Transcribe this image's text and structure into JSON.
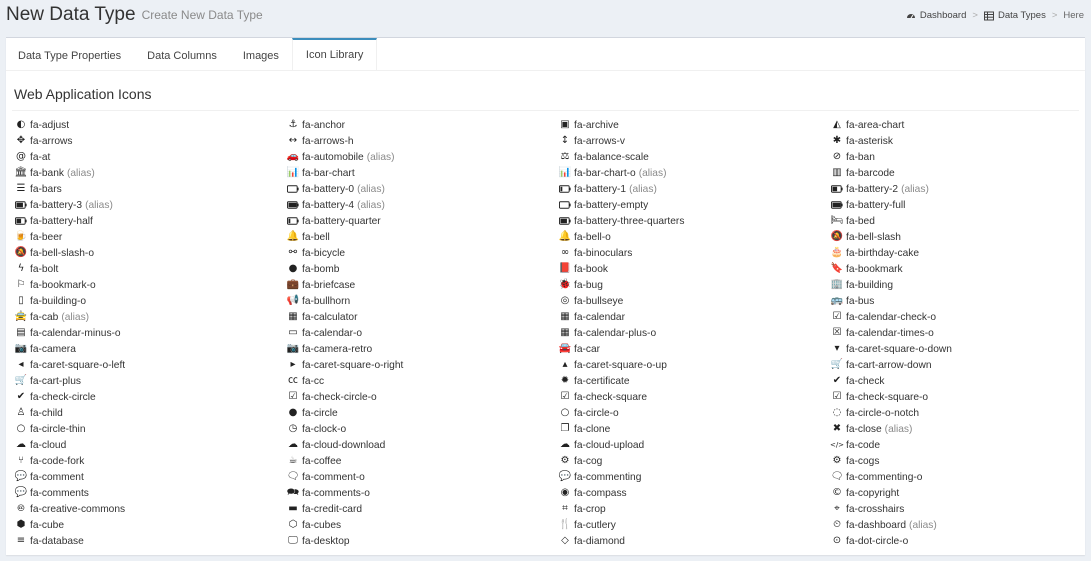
{
  "header": {
    "title": "New Data Type",
    "subtitle": "Create New Data Type",
    "breadcrumb": [
      {
        "label": "Dashboard",
        "icon": "dashboard-icon"
      },
      {
        "label": "Data Types",
        "icon": "table-icon"
      },
      {
        "label": "Here",
        "icon": ""
      }
    ],
    "breadcrumb_sep": ">"
  },
  "tabs": [
    "Data Type Properties",
    "Data Columns",
    "Images",
    "Icon Library"
  ],
  "active_tab": "Icon Library",
  "section_title": "Web Application Icons",
  "alias_label": "(alias)",
  "columns": [
    [
      {
        "name": "fa-adjust",
        "glyph": "◐"
      },
      {
        "name": "fa-arrows",
        "glyph": "✥"
      },
      {
        "name": "fa-at",
        "glyph": "@"
      },
      {
        "name": "fa-bank",
        "alias": true,
        "glyph": "🏛"
      },
      {
        "name": "fa-bars",
        "glyph": "☰"
      },
      {
        "name": "fa-battery-3",
        "alias": true,
        "glyph": "bat3"
      },
      {
        "name": "fa-battery-half",
        "glyph": "bat2"
      },
      {
        "name": "fa-beer",
        "glyph": "🍺"
      },
      {
        "name": "fa-bell-slash-o",
        "glyph": "🔕"
      },
      {
        "name": "fa-bolt",
        "glyph": "ϟ"
      },
      {
        "name": "fa-bookmark-o",
        "glyph": "⚐"
      },
      {
        "name": "fa-building-o",
        "glyph": "▯"
      },
      {
        "name": "fa-cab",
        "alias": true,
        "glyph": "🚖"
      },
      {
        "name": "fa-calendar-minus-o",
        "glyph": "▤"
      },
      {
        "name": "fa-camera",
        "glyph": "📷"
      },
      {
        "name": "fa-caret-square-o-left",
        "glyph": "◂"
      },
      {
        "name": "fa-cart-plus",
        "glyph": "🛒"
      },
      {
        "name": "fa-check-circle",
        "glyph": "✔"
      },
      {
        "name": "fa-child",
        "glyph": "♙"
      },
      {
        "name": "fa-circle-thin",
        "glyph": "○"
      },
      {
        "name": "fa-cloud",
        "glyph": "☁"
      },
      {
        "name": "fa-code-fork",
        "glyph": "⑂"
      },
      {
        "name": "fa-comment",
        "glyph": "💬"
      },
      {
        "name": "fa-comments",
        "glyph": "💬"
      },
      {
        "name": "fa-creative-commons",
        "glyph": "🅭"
      },
      {
        "name": "fa-cube",
        "glyph": "⬢"
      },
      {
        "name": "fa-database",
        "glyph": "≡"
      }
    ],
    [
      {
        "name": "fa-anchor",
        "glyph": "⚓"
      },
      {
        "name": "fa-arrows-h",
        "glyph": "↔"
      },
      {
        "name": "fa-automobile",
        "alias": true,
        "glyph": "🚗"
      },
      {
        "name": "fa-bar-chart",
        "glyph": "📊"
      },
      {
        "name": "fa-battery-0",
        "alias": true,
        "glyph": "bat0"
      },
      {
        "name": "fa-battery-4",
        "alias": true,
        "glyph": "bat4"
      },
      {
        "name": "fa-battery-quarter",
        "glyph": "bat1"
      },
      {
        "name": "fa-bell",
        "glyph": "🔔"
      },
      {
        "name": "fa-bicycle",
        "glyph": "⚯"
      },
      {
        "name": "fa-bomb",
        "glyph": "●"
      },
      {
        "name": "fa-briefcase",
        "glyph": "💼"
      },
      {
        "name": "fa-bullhorn",
        "glyph": "📢"
      },
      {
        "name": "fa-calculator",
        "glyph": "▦"
      },
      {
        "name": "fa-calendar-o",
        "glyph": "▭"
      },
      {
        "name": "fa-camera-retro",
        "glyph": "📷"
      },
      {
        "name": "fa-caret-square-o-right",
        "glyph": "▸"
      },
      {
        "name": "fa-cc",
        "glyph": "㏄"
      },
      {
        "name": "fa-check-circle-o",
        "glyph": "☑"
      },
      {
        "name": "fa-circle",
        "glyph": "●"
      },
      {
        "name": "fa-clock-o",
        "glyph": "◷"
      },
      {
        "name": "fa-cloud-download",
        "glyph": "☁"
      },
      {
        "name": "fa-coffee",
        "glyph": "☕"
      },
      {
        "name": "fa-comment-o",
        "glyph": "🗨"
      },
      {
        "name": "fa-comments-o",
        "glyph": "🗪"
      },
      {
        "name": "fa-credit-card",
        "glyph": "▬"
      },
      {
        "name": "fa-cubes",
        "glyph": "⬡"
      },
      {
        "name": "fa-desktop",
        "glyph": "🖵"
      }
    ],
    [
      {
        "name": "fa-archive",
        "glyph": "▣"
      },
      {
        "name": "fa-arrows-v",
        "glyph": "↕"
      },
      {
        "name": "fa-balance-scale",
        "glyph": "⚖"
      },
      {
        "name": "fa-bar-chart-o",
        "alias": true,
        "glyph": "📊"
      },
      {
        "name": "fa-battery-1",
        "alias": true,
        "glyph": "bat1"
      },
      {
        "name": "fa-battery-empty",
        "glyph": "bat0"
      },
      {
        "name": "fa-battery-three-quarters",
        "glyph": "bat3"
      },
      {
        "name": "fa-bell-o",
        "glyph": "🔔"
      },
      {
        "name": "fa-binoculars",
        "glyph": "∞"
      },
      {
        "name": "fa-book",
        "glyph": "📕"
      },
      {
        "name": "fa-bug",
        "glyph": "🐞"
      },
      {
        "name": "fa-bullseye",
        "glyph": "◎"
      },
      {
        "name": "fa-calendar",
        "glyph": "▦"
      },
      {
        "name": "fa-calendar-plus-o",
        "glyph": "▦"
      },
      {
        "name": "fa-car",
        "glyph": "🚘"
      },
      {
        "name": "fa-caret-square-o-up",
        "glyph": "▴"
      },
      {
        "name": "fa-certificate",
        "glyph": "✹"
      },
      {
        "name": "fa-check-square",
        "glyph": "☑"
      },
      {
        "name": "fa-circle-o",
        "glyph": "○"
      },
      {
        "name": "fa-clone",
        "glyph": "❐"
      },
      {
        "name": "fa-cloud-upload",
        "glyph": "☁"
      },
      {
        "name": "fa-cog",
        "glyph": "⚙"
      },
      {
        "name": "fa-commenting",
        "glyph": "💬"
      },
      {
        "name": "fa-compass",
        "glyph": "◉"
      },
      {
        "name": "fa-crop",
        "glyph": "⌗"
      },
      {
        "name": "fa-cutlery",
        "glyph": "🍴"
      },
      {
        "name": "fa-diamond",
        "glyph": "◇"
      }
    ],
    [
      {
        "name": "fa-area-chart",
        "glyph": "◭"
      },
      {
        "name": "fa-asterisk",
        "glyph": "✱"
      },
      {
        "name": "fa-ban",
        "glyph": "⊘"
      },
      {
        "name": "fa-barcode",
        "glyph": "▥"
      },
      {
        "name": "fa-battery-2",
        "alias": true,
        "glyph": "bat2"
      },
      {
        "name": "fa-battery-full",
        "glyph": "bat4"
      },
      {
        "name": "fa-bed",
        "glyph": "🛏"
      },
      {
        "name": "fa-bell-slash",
        "glyph": "🔕"
      },
      {
        "name": "fa-birthday-cake",
        "glyph": "🎂"
      },
      {
        "name": "fa-bookmark",
        "glyph": "🔖"
      },
      {
        "name": "fa-building",
        "glyph": "🏢"
      },
      {
        "name": "fa-bus",
        "glyph": "🚌"
      },
      {
        "name": "fa-calendar-check-o",
        "glyph": "☑"
      },
      {
        "name": "fa-calendar-times-o",
        "glyph": "☒"
      },
      {
        "name": "fa-caret-square-o-down",
        "glyph": "▾"
      },
      {
        "name": "fa-cart-arrow-down",
        "glyph": "🛒"
      },
      {
        "name": "fa-check",
        "glyph": "✔"
      },
      {
        "name": "fa-check-square-o",
        "glyph": "☑"
      },
      {
        "name": "fa-circle-o-notch",
        "glyph": "◌"
      },
      {
        "name": "fa-close",
        "alias": true,
        "glyph": "✖"
      },
      {
        "name": "fa-code",
        "glyph": "</>"
      },
      {
        "name": "fa-cogs",
        "glyph": "⚙"
      },
      {
        "name": "fa-commenting-o",
        "glyph": "🗨"
      },
      {
        "name": "fa-copyright",
        "glyph": "©"
      },
      {
        "name": "fa-crosshairs",
        "glyph": "⌖"
      },
      {
        "name": "fa-dashboard",
        "alias": true,
        "glyph": "⏲"
      },
      {
        "name": "fa-dot-circle-o",
        "glyph": "⊙"
      }
    ]
  ]
}
